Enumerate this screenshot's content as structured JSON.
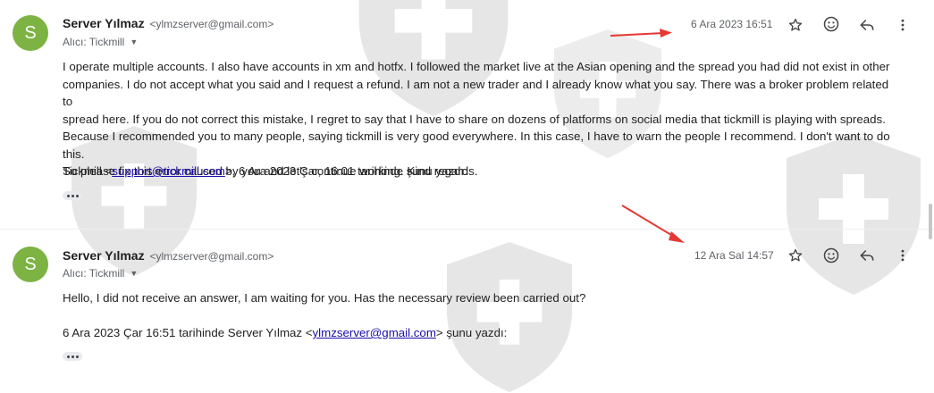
{
  "messages": [
    {
      "avatar_letter": "S",
      "sender_name": "Server Yılmaz",
      "sender_email": "<ylmzserver@gmail.com>",
      "to": "Alıcı: Tickmill",
      "date": "6 Ara 2023 16:51",
      "body_lines": [
        "I operate multiple accounts. I also have accounts in xm and hotfx. I followed the market live at the Asian opening and the spread you had did not exist in other",
        "companies. I do not accept what you said and I request a refund. I am not a new trader and I already know what you say. There was a broker problem related to",
        "spread here. If you do not correct this mistake, I regret to say that I have to share on dozens of platforms on social media that tickmill is playing with spreads.",
        "Because I recommended you to many people, saying tickmill is very good everywhere. In this case, I have to warn the people I recommend. I don't want to do this.",
        "So please fix this error caused by you and let's continue working. Kind regards."
      ],
      "quote_prefix": "Tickmill <",
      "quote_link": "support@tickmill.com",
      "quote_suffix": ">, 6 Ara 2023 Çar, 16:01 tarihinde şunu yazdı:"
    },
    {
      "avatar_letter": "S",
      "sender_name": "Server Yılmaz",
      "sender_email": "<ylmzserver@gmail.com>",
      "to": "Alıcı: Tickmill",
      "date": "12 Ara Sal 14:57",
      "body_lines": [
        "Hello, I did not receive an answer, I am waiting for you. Has the necessary review been carried out?"
      ],
      "quote_prefix": "6 Ara 2023 Çar 16:51 tarihinde Server Yılmaz <",
      "quote_link": "ylmzserver@gmail.com",
      "quote_suffix": "> şunu yazdı:"
    }
  ],
  "colors": {
    "avatar": "#7cb342",
    "link": "#1a0dab",
    "arrow": "#e53935",
    "watermark": "#e6e6e6"
  },
  "icons": [
    "star-icon",
    "emoji-icon",
    "reply-icon",
    "more-vert-icon",
    "shield-watermark-icon"
  ]
}
